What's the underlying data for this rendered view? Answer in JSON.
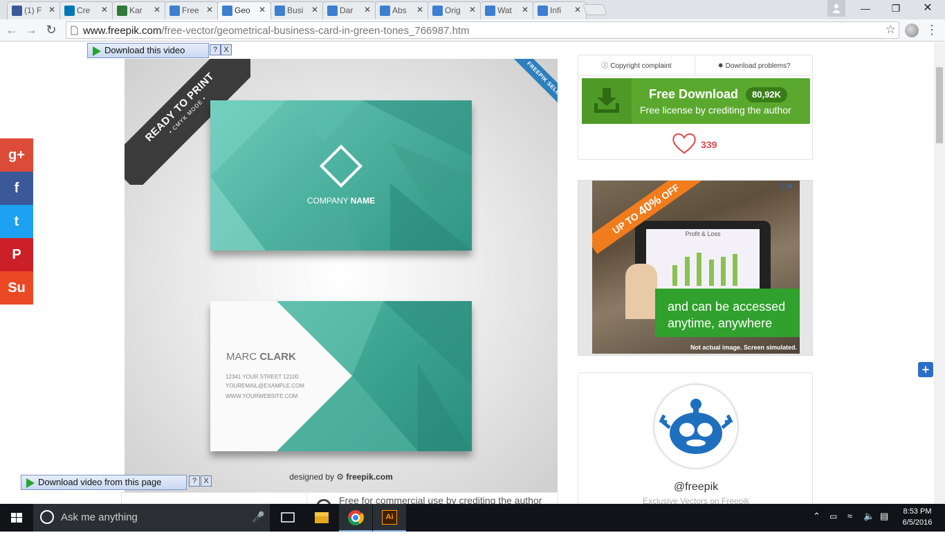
{
  "tabs": [
    {
      "label": "(1) F",
      "icon": "facebook-icon",
      "color": "#3b5998"
    },
    {
      "label": "Cre",
      "icon": "linkedin-icon",
      "color": "#0077b5"
    },
    {
      "label": "Kar",
      "icon": "site-icon",
      "color": "#2f7a3b"
    },
    {
      "label": "Free",
      "icon": "freepik-icon",
      "color": "#3d7fd0"
    },
    {
      "label": "Geo",
      "icon": "freepik-icon",
      "color": "#3d7fd0",
      "active": true
    },
    {
      "label": "Busi",
      "icon": "freepik-icon",
      "color": "#3d7fd0"
    },
    {
      "label": "Dar",
      "icon": "freepik-icon",
      "color": "#3d7fd0"
    },
    {
      "label": "Abs",
      "icon": "freepik-icon",
      "color": "#3d7fd0"
    },
    {
      "label": "Orig",
      "icon": "freepik-icon",
      "color": "#3d7fd0"
    },
    {
      "label": "Wat",
      "icon": "freepik-icon",
      "color": "#3d7fd0"
    },
    {
      "label": "Infi",
      "icon": "freepik-icon",
      "color": "#3d7fd0"
    }
  ],
  "address": {
    "domain": "www.freepik.com",
    "path": "/free-vector/geometrical-business-card-in-green-tones_766987.htm"
  },
  "download_video": {
    "top_label": "Download this video",
    "bottom_label": "Download video from this page",
    "help": "?",
    "close": "X"
  },
  "social": [
    {
      "name": "googleplus",
      "glyph": "g+",
      "color": "#dc4a38"
    },
    {
      "name": "facebook",
      "glyph": "f",
      "color": "#3b5998"
    },
    {
      "name": "twitter",
      "glyph": "t",
      "color": "#1da1f2"
    },
    {
      "name": "pinterest",
      "glyph": "P",
      "color": "#cb2027"
    },
    {
      "name": "stumbleupon",
      "glyph": "Su",
      "color": "#eb4924"
    }
  ],
  "preview": {
    "ribbon_line1": "READY TO PRINT",
    "ribbon_line2": "• CMYK MODE •",
    "selection_ribbon": "FREEPIK SELECTION",
    "company_light": "COMPANY ",
    "company_bold": "NAME",
    "person_first": "MARC ",
    "person_last": "CLARK",
    "contact": [
      "12341  YOUR STREET 12100",
      "YOUREMAIL@EXAMPLE.COM",
      "WWW.YOURWEBSITE.COM"
    ],
    "designed_prefix": "designed by ",
    "designed_brand": "freepik.com"
  },
  "below": {
    "license_text": "Free for commercial use by crediting the author"
  },
  "panel": {
    "copyright": "Copyright complaint",
    "problems": "Download problems?",
    "download_title": "Free Download",
    "download_count": "80,92K",
    "download_sub": "Free license by crediting the author",
    "likes": "339",
    "accent": "#5aa92e"
  },
  "ad": {
    "ribbon_pre": "UP TO ",
    "ribbon_pct": "40%",
    "ribbon_post": " OFF",
    "screen_title": "Profit & Loss",
    "message_line1": "and can be accessed",
    "message_line2": "anytime, anywhere",
    "footnote": "Not actual image. Screen simulated."
  },
  "profile": {
    "handle": "@freepik",
    "subtitle": "Exclusive Vectors on Freepik"
  },
  "taskbar": {
    "search_placeholder": "Ask me anything",
    "time": "8:53 PM",
    "date": "6/5/2016"
  }
}
